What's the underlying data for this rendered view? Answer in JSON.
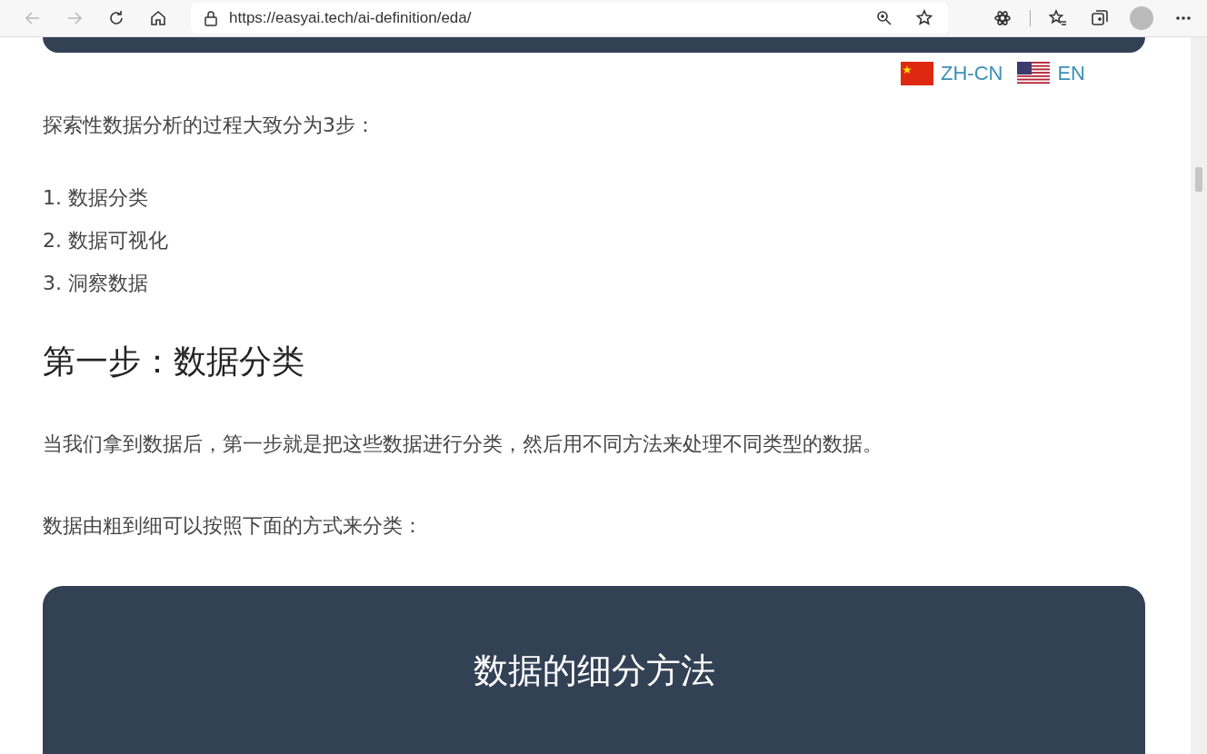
{
  "browser": {
    "url": "https://easyai.tech/ai-definition/eda/"
  },
  "languages": [
    {
      "kind": "cn",
      "label": "ZH-CN"
    },
    {
      "kind": "us",
      "label": "EN"
    }
  ],
  "intro": "探索性数据分析的过程大致分为3步：",
  "steps": [
    "1. 数据分类",
    "2. 数据可视化",
    "3. 洞察数据"
  ],
  "heading": "第一步：数据分类",
  "paragraphs": [
    "当我们拿到数据后，第一步就是把这些数据进行分类，然后用不同方法来处理不同类型的数据。",
    "数据由粗到细可以按照下面的方式来分类："
  ],
  "card": {
    "title": "数据的细分方法"
  }
}
